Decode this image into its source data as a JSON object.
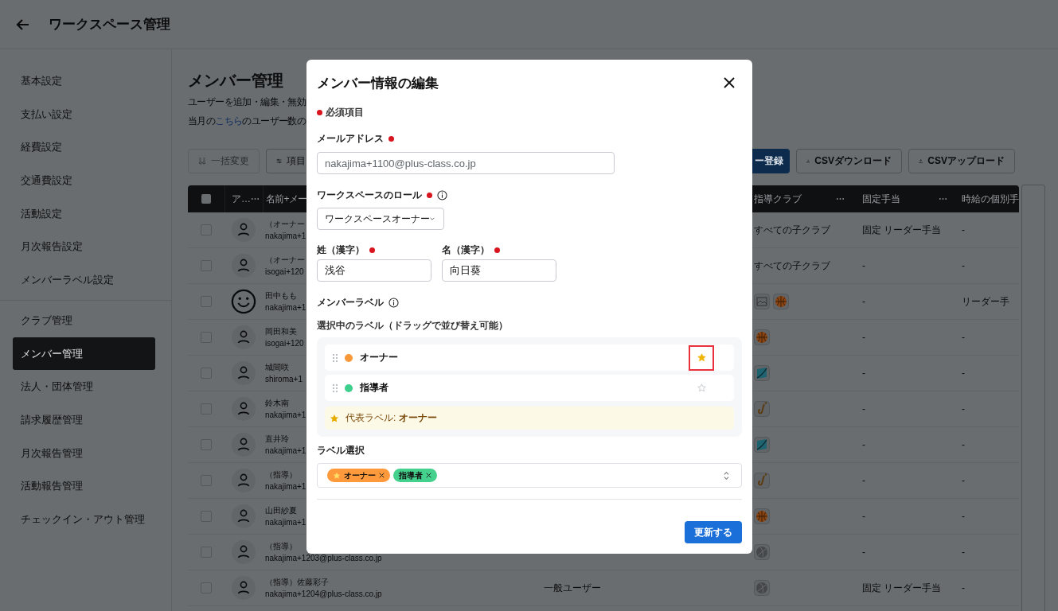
{
  "header": {
    "title": "ワークスペース管理"
  },
  "sidebar": {
    "sections": [
      {
        "items": [
          {
            "label": "基本設定",
            "selected": false
          },
          {
            "label": "支払い設定",
            "selected": false
          },
          {
            "label": "経費設定",
            "selected": false
          },
          {
            "label": "交通費設定",
            "selected": false
          },
          {
            "label": "活動設定",
            "selected": false
          },
          {
            "label": "月次報告設定",
            "selected": false
          },
          {
            "label": "メンバーラベル設定",
            "selected": false
          }
        ]
      },
      {
        "items": [
          {
            "label": "クラブ管理",
            "selected": false
          },
          {
            "label": "メンバー管理",
            "selected": true
          },
          {
            "label": "法人・団体管理",
            "selected": false
          },
          {
            "label": "請求履歴管理",
            "selected": false
          },
          {
            "label": "月次報告管理",
            "selected": false
          },
          {
            "label": "活動報告管理",
            "selected": false
          },
          {
            "label": "チェックイン・アウト管理",
            "selected": false
          }
        ]
      }
    ]
  },
  "page": {
    "title": "メンバー管理",
    "description": "ユーザーを追加・編集・無効",
    "note_before": "当月の",
    "note_link": "こちら",
    "note_after": "のユーザー数の"
  },
  "toolbar": {
    "left": [
      {
        "label": "一括変更",
        "kind": "bulk",
        "disabled": true
      },
      {
        "label": "項目",
        "kind": "columns",
        "disabled": false
      }
    ],
    "right": [
      {
        "label": "ー登録",
        "kind": "primary"
      },
      {
        "label": "CSVダウンロード",
        "kind": "download"
      },
      {
        "label": "CSVアップロード",
        "kind": "upload"
      }
    ]
  },
  "table": {
    "all_checked": false,
    "columns": [
      {
        "label": "ア…",
        "menu": true
      },
      {
        "label": "名前+メー",
        "menu": false
      },
      {
        "label": "指導クラブ",
        "menu": true
      },
      {
        "label": "固定手当",
        "menu": true
      },
      {
        "label": "時給の個別手",
        "menu": false
      }
    ],
    "rows": [
      {
        "checked": false,
        "avatar": {
          "kind": "default"
        },
        "name": "（オーナー",
        "email": "nakajima+1",
        "clubs": "すべての子クラブ",
        "fixed": "固定 リーダー手当",
        "hourly": "-"
      },
      {
        "checked": false,
        "avatar": {
          "kind": "default"
        },
        "name": "（オーナー",
        "email": "isogai+120",
        "clubs": "すべての子クラブ",
        "fixed": "-",
        "hourly": "-"
      },
      {
        "checked": false,
        "avatar": {
          "kind": "custom"
        },
        "name": "田中もも",
        "email": "nakajima+1",
        "club_icons": [
          {
            "kind": "image"
          },
          {
            "kind": "basketball"
          }
        ],
        "fixed": "-",
        "hourly": "リーダー手"
      },
      {
        "checked": false,
        "avatar": {
          "kind": "default"
        },
        "name": "岡田和美",
        "email": "isogai+120",
        "club_icons": [
          {
            "kind": "basketball"
          }
        ],
        "fixed": "-",
        "hourly": "-"
      },
      {
        "checked": false,
        "avatar": {
          "kind": "default"
        },
        "name": "城間咲",
        "email": "shiroma+1",
        "club_icons": [
          {
            "kind": "flag"
          }
        ],
        "fixed": "-",
        "hourly": "-"
      },
      {
        "checked": false,
        "avatar": {
          "kind": "default"
        },
        "name": "鈴木南",
        "email": "nakajima+1",
        "club_icons": [
          {
            "kind": "sax"
          }
        ],
        "fixed": "-",
        "hourly": "-"
      },
      {
        "checked": false,
        "avatar": {
          "kind": "default"
        },
        "name": "直井玲",
        "email": "nakajima+1",
        "club_icons": [
          {
            "kind": "flag"
          }
        ],
        "fixed": "-",
        "hourly": "-"
      },
      {
        "checked": false,
        "avatar": {
          "kind": "default"
        },
        "name": "（指導）",
        "email": "nakajima+1",
        "club_icons": [
          {
            "kind": "sax"
          }
        ],
        "fixed": "-",
        "hourly": "-"
      },
      {
        "checked": false,
        "avatar": {
          "kind": "default"
        },
        "name": "山田紗夏",
        "email": "nakajima+1",
        "club_icons": [
          {
            "kind": "basketball"
          }
        ],
        "fixed": "-",
        "hourly": "-"
      },
      {
        "checked": false,
        "avatar": {
          "kind": "default"
        },
        "name": "（指導）",
        "email": "nakajima+1203@plus-class.co.jp",
        "club_icons": [
          {
            "kind": "ball"
          }
        ],
        "fixed": "-",
        "hourly": "-"
      },
      {
        "checked": false,
        "avatar": {
          "kind": "default"
        },
        "name": "（指導）佐藤彩子",
        "email": "nakajima+1204@plus-class.co.jp",
        "role": "一般ユーザー",
        "club_icons": [
          {
            "kind": "ball"
          }
        ],
        "fixed": "固定 リーダー手当",
        "hourly": "-"
      }
    ]
  },
  "modal": {
    "title": "メンバー情報の編集",
    "required_note": "必須項目",
    "email": {
      "label": "メールアドレス",
      "required": true,
      "value": "nakajima+1100@plus-class.co.jp",
      "disabled": true
    },
    "role": {
      "label": "ワークスペースのロール",
      "required": true,
      "info": true,
      "value": "ワークスペースオーナー"
    },
    "last_name": {
      "label": "姓（漢字）",
      "required": true,
      "value": "浅谷"
    },
    "first_name": {
      "label": "名（漢字）",
      "required": true,
      "value": "向日葵"
    },
    "labels": {
      "label": "メンバーラベル",
      "info": true,
      "selected_heading": "選択中のラベル（ドラッグで並び替え可能）",
      "selected": [
        {
          "name": "オーナー",
          "color": "#f7993a",
          "primary": true,
          "highlighted": true
        },
        {
          "name": "指導者",
          "color": "#3ecf8e",
          "primary": false,
          "highlighted": false
        }
      ],
      "primary_note": "代表ラベル: **オーナー**",
      "select_label": "ラベル選択",
      "chips": [
        {
          "name": "オーナー",
          "color": "#ff9a3c",
          "primary": true
        },
        {
          "name": "指導者",
          "color": "#44d18e",
          "primary": false
        }
      ]
    },
    "submit": "更新する"
  }
}
